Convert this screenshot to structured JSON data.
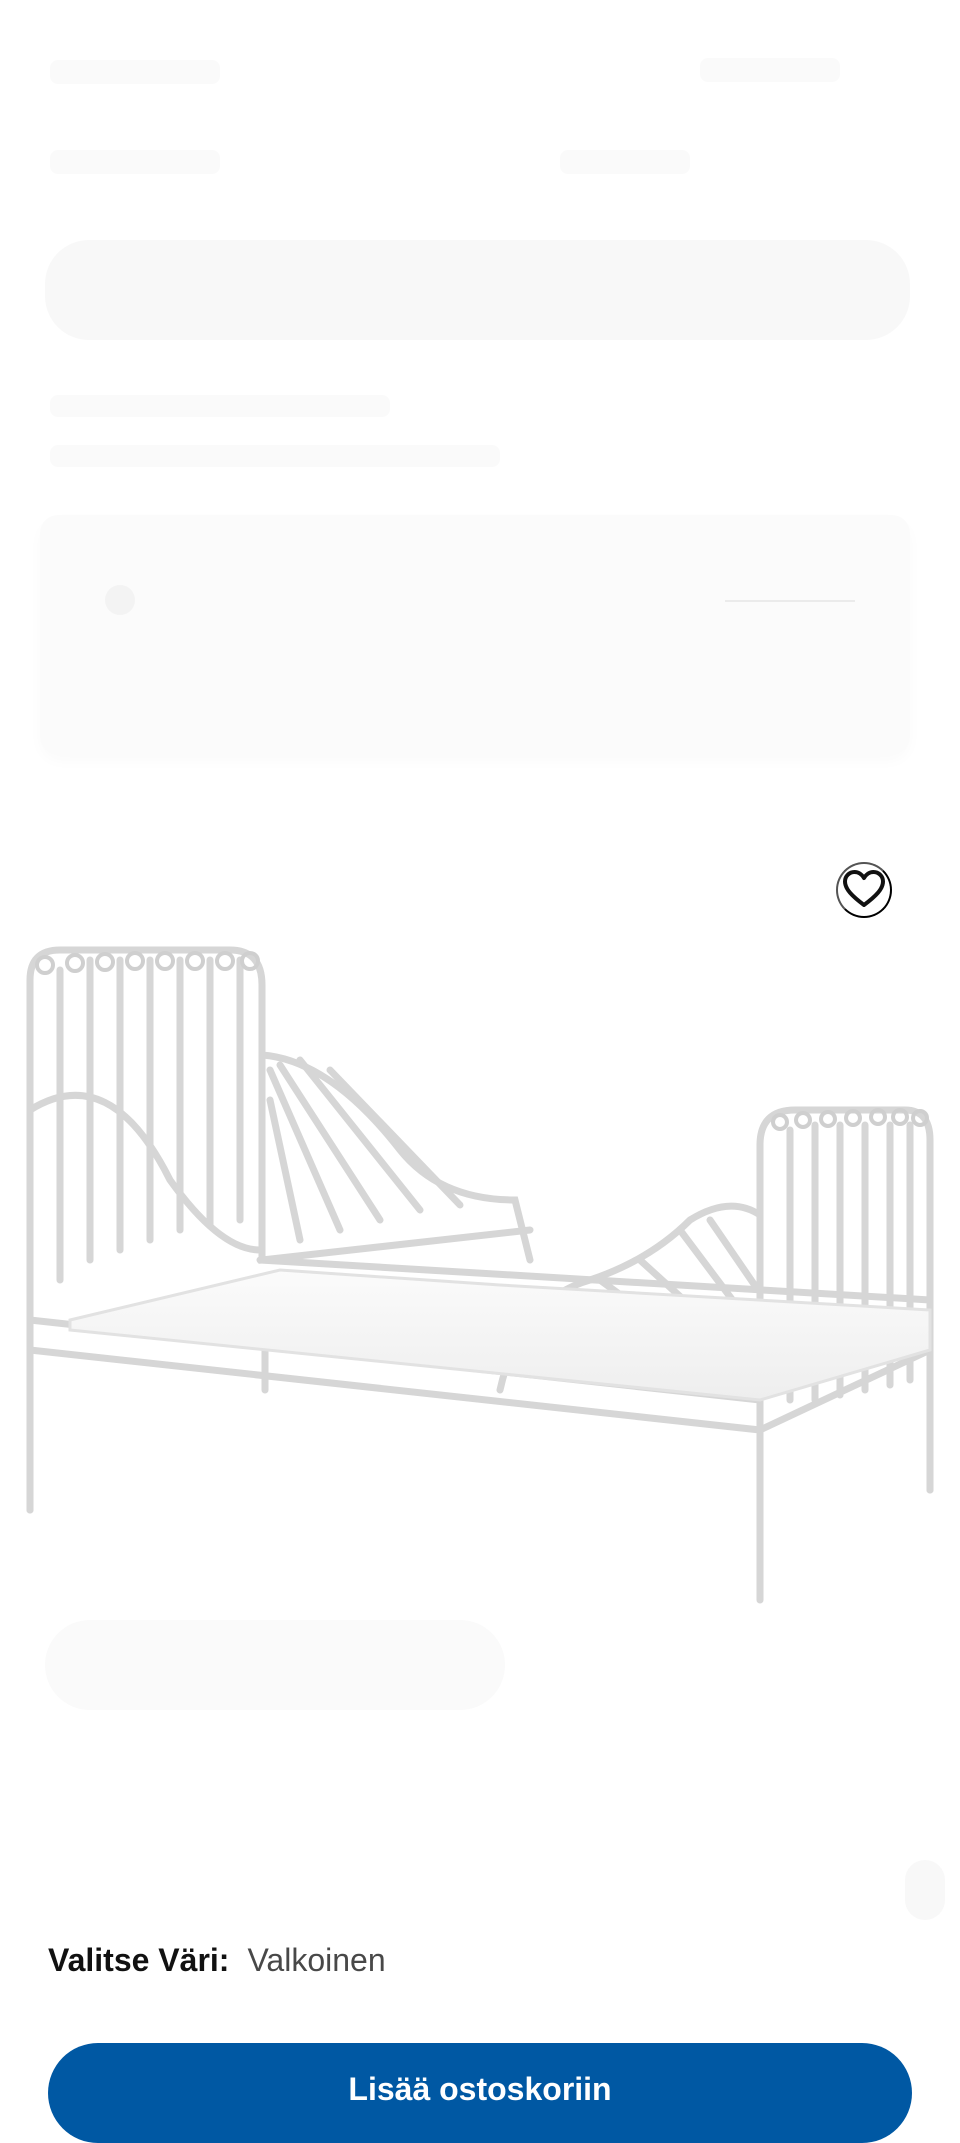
{
  "colors": {
    "accent": "#0058a3",
    "text_primary": "#111111",
    "text_secondary": "#484848"
  },
  "product": {
    "favourite_icon": "heart-icon",
    "image_icon": "bed-frame-image"
  },
  "color_selector": {
    "label": "Valitse Väri:",
    "value": "Valkoinen"
  },
  "actions": {
    "add_to_cart_label": "Lisää ostoskoriin"
  }
}
